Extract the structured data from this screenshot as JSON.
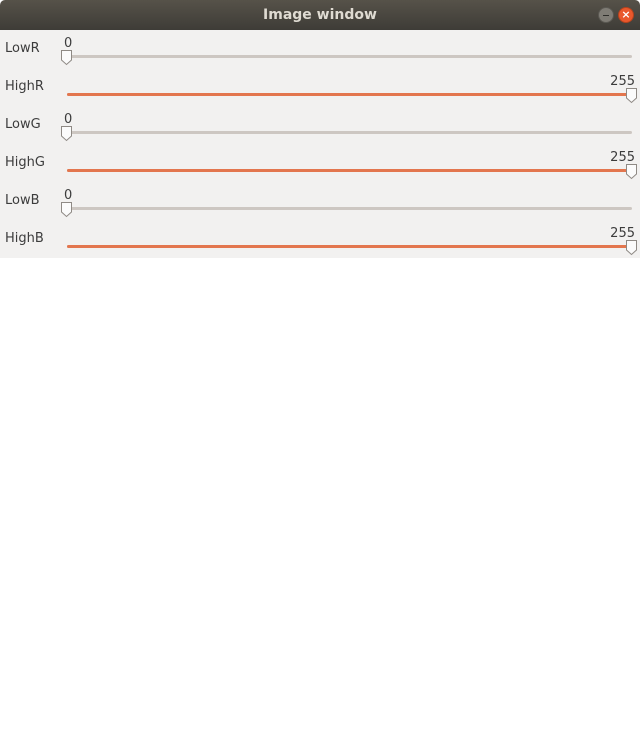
{
  "window": {
    "title": "Image window",
    "minimize_label": "–",
    "close_label": "×"
  },
  "sliders": [
    {
      "label": "LowR",
      "value": "0",
      "max": 255,
      "level": 0
    },
    {
      "label": "HighR",
      "value": "255",
      "max": 255,
      "level": 1
    },
    {
      "label": "LowG",
      "value": "0",
      "max": 255,
      "level": 0
    },
    {
      "label": "HighG",
      "value": "255",
      "max": 255,
      "level": 1
    },
    {
      "label": "LowB",
      "value": "0",
      "max": 255,
      "level": 0
    },
    {
      "label": "HighB",
      "value": "255",
      "max": 255,
      "level": 1
    }
  ],
  "colors": {
    "accent": "#e3764e",
    "trough": "#cdc7c2",
    "panel": "#f2f1f0",
    "titlebar": "#46443f"
  }
}
